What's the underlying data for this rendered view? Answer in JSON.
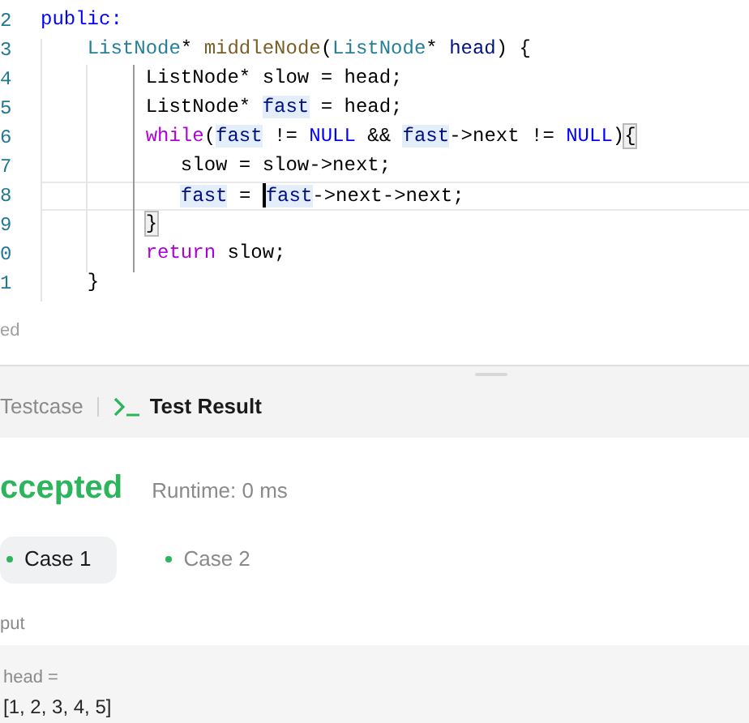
{
  "editor": {
    "lines": [
      {
        "number": "2",
        "current": false,
        "tokens": [
          {
            "text": "public:",
            "kind": "keyword"
          }
        ]
      },
      {
        "number": "3",
        "current": false,
        "tokens": [
          {
            "text": "    ListNode",
            "kind": "type"
          },
          {
            "text": "* ",
            "kind": "plain"
          },
          {
            "text": "middleNode",
            "kind": "function"
          },
          {
            "text": "(",
            "kind": "plain"
          },
          {
            "text": "ListNode",
            "kind": "type"
          },
          {
            "text": "* ",
            "kind": "plain"
          },
          {
            "text": "head",
            "kind": "param"
          },
          {
            "text": ") {",
            "kind": "plain"
          }
        ]
      },
      {
        "number": "4",
        "current": false,
        "tokens": [
          {
            "text": "         ListNode* slow = head;",
            "kind": "plain"
          }
        ]
      },
      {
        "number": "5",
        "current": false,
        "tokens": [
          {
            "text": "         ListNode* ",
            "kind": "plain"
          },
          {
            "text": "fast",
            "kind": "occurrence"
          },
          {
            "text": " = head;",
            "kind": "plain"
          }
        ]
      },
      {
        "number": "6",
        "current": false,
        "tokens": [
          {
            "text": "         while",
            "kind": "control"
          },
          {
            "text": "(",
            "kind": "plain"
          },
          {
            "text": "fast",
            "kind": "occurrence"
          },
          {
            "text": " != ",
            "kind": "plain"
          },
          {
            "text": "NULL",
            "kind": "constant"
          },
          {
            "text": " && ",
            "kind": "plain"
          },
          {
            "text": "fast",
            "kind": "occurrence"
          },
          {
            "text": "->next != ",
            "kind": "plain"
          },
          {
            "text": "NULL",
            "kind": "constant"
          },
          {
            "text": ")",
            "kind": "plain"
          },
          {
            "text": "{",
            "kind": "bracket"
          }
        ]
      },
      {
        "number": "7",
        "current": false,
        "tokens": [
          {
            "text": "            slow = slow->next;",
            "kind": "plain"
          }
        ]
      },
      {
        "number": "8",
        "current": true,
        "tokens": [
          {
            "text": "            fast",
            "kind": "occurrence"
          },
          {
            "text": " = ",
            "kind": "plain"
          },
          {
            "kind": "caret"
          },
          {
            "text": "fast",
            "kind": "occurrence"
          },
          {
            "text": "->next->next;",
            "kind": "plain"
          }
        ]
      },
      {
        "number": "9",
        "current": false,
        "tokens": [
          {
            "text": "         }",
            "kind": "bracket"
          }
        ]
      },
      {
        "number": "0",
        "current": false,
        "tokens": [
          {
            "text": "         return",
            "kind": "control"
          },
          {
            "text": " slow;",
            "kind": "plain"
          }
        ]
      },
      {
        "number": "1",
        "current": false,
        "tokens": [
          {
            "text": "    }",
            "kind": "plain"
          }
        ]
      }
    ]
  },
  "status": "ed",
  "panel": {
    "tabs": [
      {
        "label": "Testcase",
        "selected": false
      },
      {
        "label": "Test Result",
        "selected": true
      }
    ],
    "verdict": "ccepted",
    "runtime": "Runtime: 0 ms",
    "cases": [
      {
        "label": "Case 1",
        "selected": true,
        "color": "#2db55d"
      },
      {
        "label": "Case 2",
        "selected": false,
        "color": "#2db55d"
      }
    ],
    "input_label": "put",
    "param_name": "head =",
    "param_value": "[1, 2, 3, 4, 5]"
  }
}
